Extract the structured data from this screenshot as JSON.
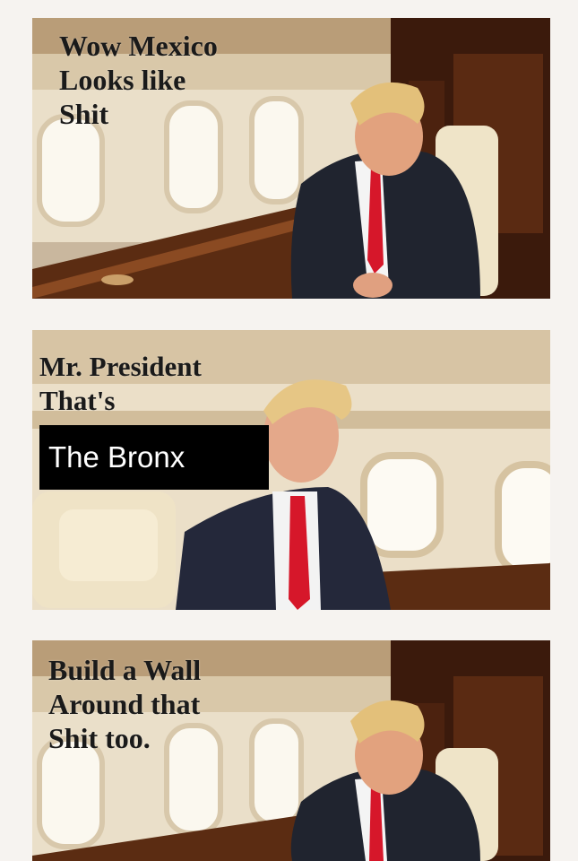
{
  "panels": [
    {
      "caption": "Wow Mexico\nLooks like\nShit"
    },
    {
      "caption": "Mr. President\nThat's"
    },
    {
      "caption": "Build a Wall\nAround that\nShit too."
    }
  ],
  "overlay": {
    "text": "The Bronx"
  },
  "colors": {
    "background": "#f6f3f0",
    "cabin_wall": "#e8dcc6",
    "wood": "#4a2410",
    "suit": "#1f2330",
    "tie": "#d6172a",
    "hair": "#e3c07a",
    "skin": "#e2a27e"
  }
}
